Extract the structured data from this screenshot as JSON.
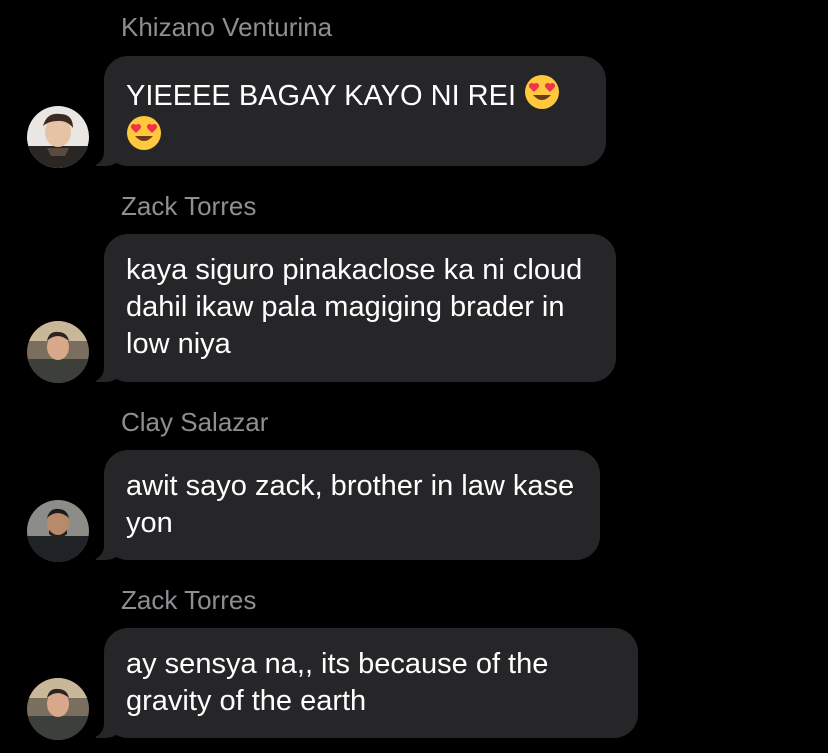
{
  "conversation": {
    "messages": [
      {
        "sender": "Khizano Venturina",
        "text": "YIEEEE BAGAY KAYO NI REI",
        "emojis": [
          "smiling-face-with-heart-eyes",
          "smiling-face-with-heart-eyes"
        ],
        "avatar_icon": "avatar-khizano"
      },
      {
        "sender": "Zack Torres",
        "text": "kaya siguro pinakaclose ka ni cloud dahil ikaw pala magiging brader in low niya",
        "avatar_icon": "avatar-zack"
      },
      {
        "sender": "Clay Salazar",
        "text": "awit sayo zack, brother in law kase yon",
        "avatar_icon": "avatar-clay"
      },
      {
        "sender": "Zack Torres",
        "text": "ay sensya na,, its because of the gravity of the earth",
        "avatar_icon": "avatar-zack"
      }
    ]
  },
  "colors": {
    "background": "#000000",
    "bubble": "#262629",
    "sender_name": "#8e8e93",
    "message_text": "#ffffff",
    "emoji_face": "#ffc83d",
    "emoji_heart": "#f0324f"
  }
}
